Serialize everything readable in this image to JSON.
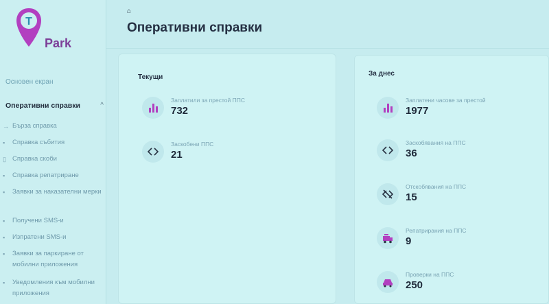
{
  "app": {
    "logo_letter": "T",
    "logo_text": "Park"
  },
  "sidebar": {
    "main_item": "Основен екран",
    "section": "Оперативни справки",
    "items": [
      {
        "label": "Бърза справка",
        "icon": "arrow-icon"
      },
      {
        "label": "Справка събития",
        "icon": "list-icon"
      },
      {
        "label": "Справка скоби",
        "icon": "lock-icon"
      },
      {
        "label": "Справка репатриране",
        "icon": "truck-icon"
      },
      {
        "label": "Заявки за наказателни мерки",
        "icon": "flag-icon"
      },
      {
        "label": "Получени SMS-и",
        "icon": "inbox-icon"
      },
      {
        "label": "Изпратени SMS-и",
        "icon": "send-icon"
      },
      {
        "label": "Заявки за паркиране от мобилни приложения",
        "icon": "phone-icon"
      },
      {
        "label": "Уведомления към мобилни приложения",
        "icon": "bell-icon"
      }
    ]
  },
  "header": {
    "title": "Оперативни справки"
  },
  "current": {
    "title": "Текущи",
    "stats": [
      {
        "label": "Заплатили за престой ППС",
        "value": "732",
        "icon": "bar-chart-icon"
      },
      {
        "label": "Заскобени ППС",
        "value": "21",
        "icon": "code-icon"
      }
    ]
  },
  "today": {
    "title": "За днес",
    "stats": [
      {
        "label": "Заплатени часове за престой",
        "value": "1977",
        "icon": "bar-chart-icon"
      },
      {
        "label": "Заскобявания на ППС",
        "value": "36",
        "icon": "code-icon"
      },
      {
        "label": "Отскобявания на ППС",
        "value": "15",
        "icon": "code-off-icon"
      },
      {
        "label": "Репатрирания на ППС",
        "value": "9",
        "icon": "tow-truck-icon"
      },
      {
        "label": "Проверки на ППС",
        "value": "250",
        "icon": "car-icon"
      }
    ]
  },
  "colors": {
    "accent": "#b23fc0",
    "brand": "#7d3f98",
    "background": "#c6ecef"
  }
}
